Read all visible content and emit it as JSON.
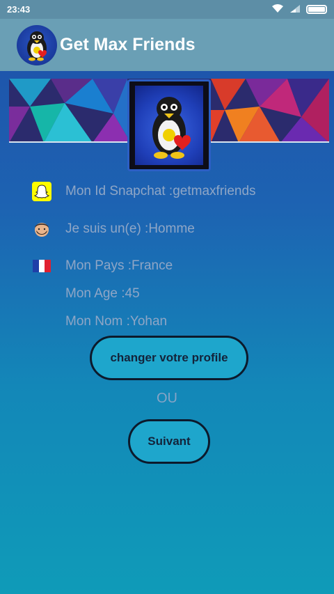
{
  "status_bar": {
    "time": "23:43",
    "icons": [
      "wifi-icon",
      "signal-icon",
      "battery-icon"
    ]
  },
  "app_bar": {
    "title": "Get Max Friends",
    "logo_icon": "penguin-logo-icon"
  },
  "profile": {
    "avatar_icon": "penguin-avatar-icon",
    "fields": [
      {
        "icon": "snapchat-icon",
        "text": "Mon Id Snapchat :getmaxfriends"
      },
      {
        "icon": "man-face-icon",
        "text": "Je suis un(e) :Homme"
      },
      {
        "icon": "france-flag-icon",
        "text": "Mon Pays :France"
      },
      {
        "icon": "",
        "text": "Mon Age :45"
      },
      {
        "icon": "",
        "text": "Mon Nom :Yohan"
      }
    ]
  },
  "actions": {
    "change_profile_label": "changer votre profile",
    "or_label": "OU",
    "next_label": "Suivant"
  },
  "colors": {
    "status_bar": "#5d8ea6",
    "app_bar": "#6a9fb5",
    "background_top": "#1f4fa8",
    "background_bottom": "#0f9bb8",
    "button_fill": "#1ea6cc",
    "text_muted": "#8fa6c6"
  }
}
